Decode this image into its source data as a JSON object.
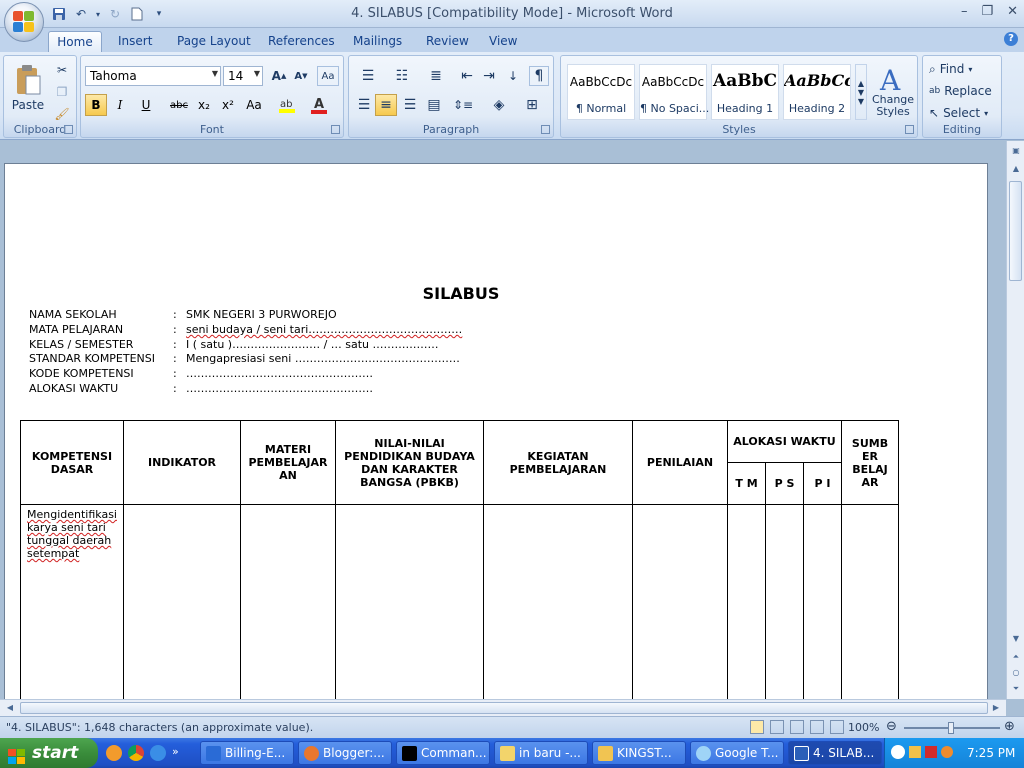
{
  "window": {
    "title": "4. SILABUS [Compatibility Mode] - Microsoft Word",
    "controls": [
      "minimize",
      "restore",
      "close"
    ]
  },
  "ribbon": {
    "tabs": [
      "Home",
      "Insert",
      "Page Layout",
      "References",
      "Mailings",
      "Review",
      "View"
    ],
    "active_tab": "Home",
    "groups": {
      "clipboard": {
        "label": "Clipboard",
        "paste": "Paste"
      },
      "font": {
        "label": "Font",
        "font_name": "Tahoma",
        "font_size": "14",
        "bold": "B",
        "italic": "I",
        "underline": "U",
        "strike": "abc",
        "sub": "x₂",
        "sup": "x²",
        "case": "Aa"
      },
      "paragraph": {
        "label": "Paragraph"
      },
      "styles": {
        "label": "Styles",
        "items": [
          {
            "sample": "AaBbCcDc",
            "name": "¶ Normal"
          },
          {
            "sample": "AaBbCcDc",
            "name": "¶ No Spaci..."
          },
          {
            "sample": "AaBbC",
            "name": "Heading 1"
          },
          {
            "sample": "AaBbCc",
            "name": "Heading 2"
          }
        ],
        "change_styles": "Change Styles"
      },
      "editing": {
        "label": "Editing",
        "find": "Find",
        "replace": "Replace",
        "select": "Select"
      }
    }
  },
  "document": {
    "title": "SILABUS",
    "info": [
      {
        "label": "NAMA SEKOLAH",
        "colon": ":",
        "value": "SMK NEGERI 3 PURWOREJO"
      },
      {
        "label": "MATA PELAJARAN",
        "colon": ":",
        "value": "seni budaya / seni tari……………………………………"
      },
      {
        "label": "KELAS / SEMESTER",
        "colon": ":",
        "value": "I  ( satu )…………………… / … satu ………………"
      },
      {
        "label": "STANDAR KOMPETENSI",
        "colon": ":",
        "value": "Mengapresiasi seni ………………………………………"
      },
      {
        "label": "KODE KOMPETENSI",
        "colon": ":",
        "value": "……………………………………………"
      },
      {
        "label": "ALOKASI WAKTU",
        "colon": ":",
        "value": "……………………………………………"
      }
    ],
    "table": {
      "headers": {
        "kd": "KOMPETENSI DASAR",
        "indikator": "INDIKATOR",
        "materi": "MATERI PEMBELAJAR AN",
        "nilai": "NILAI-NILAI PENDIDIKAN BUDAYA DAN KARAKTER BANGSA (PBKB)",
        "kegiatan": "KEGIATAN PEMBELAJARAN",
        "penilaian": "PENILAIAN",
        "alokasi": "ALOKASI WAKTU",
        "tm": "T M",
        "ps": "P S",
        "pi": "P I",
        "sumber": "SUMB ER BELAJ AR"
      },
      "row1": {
        "kd": "Mengidentifikasi karya seni tari tunggal daerah setempat"
      }
    }
  },
  "statusbar": {
    "text": "\"4. SILABUS\": 1,648 characters (an approximate value).",
    "zoom": "100%"
  },
  "taskbar": {
    "start": "start",
    "tasks": [
      "Billing-E...",
      "Blogger:...",
      "Comman...",
      "in baru -...",
      "KINGST...",
      "Google T...",
      "4. SILAB..."
    ],
    "clock": "7:25 PM"
  }
}
